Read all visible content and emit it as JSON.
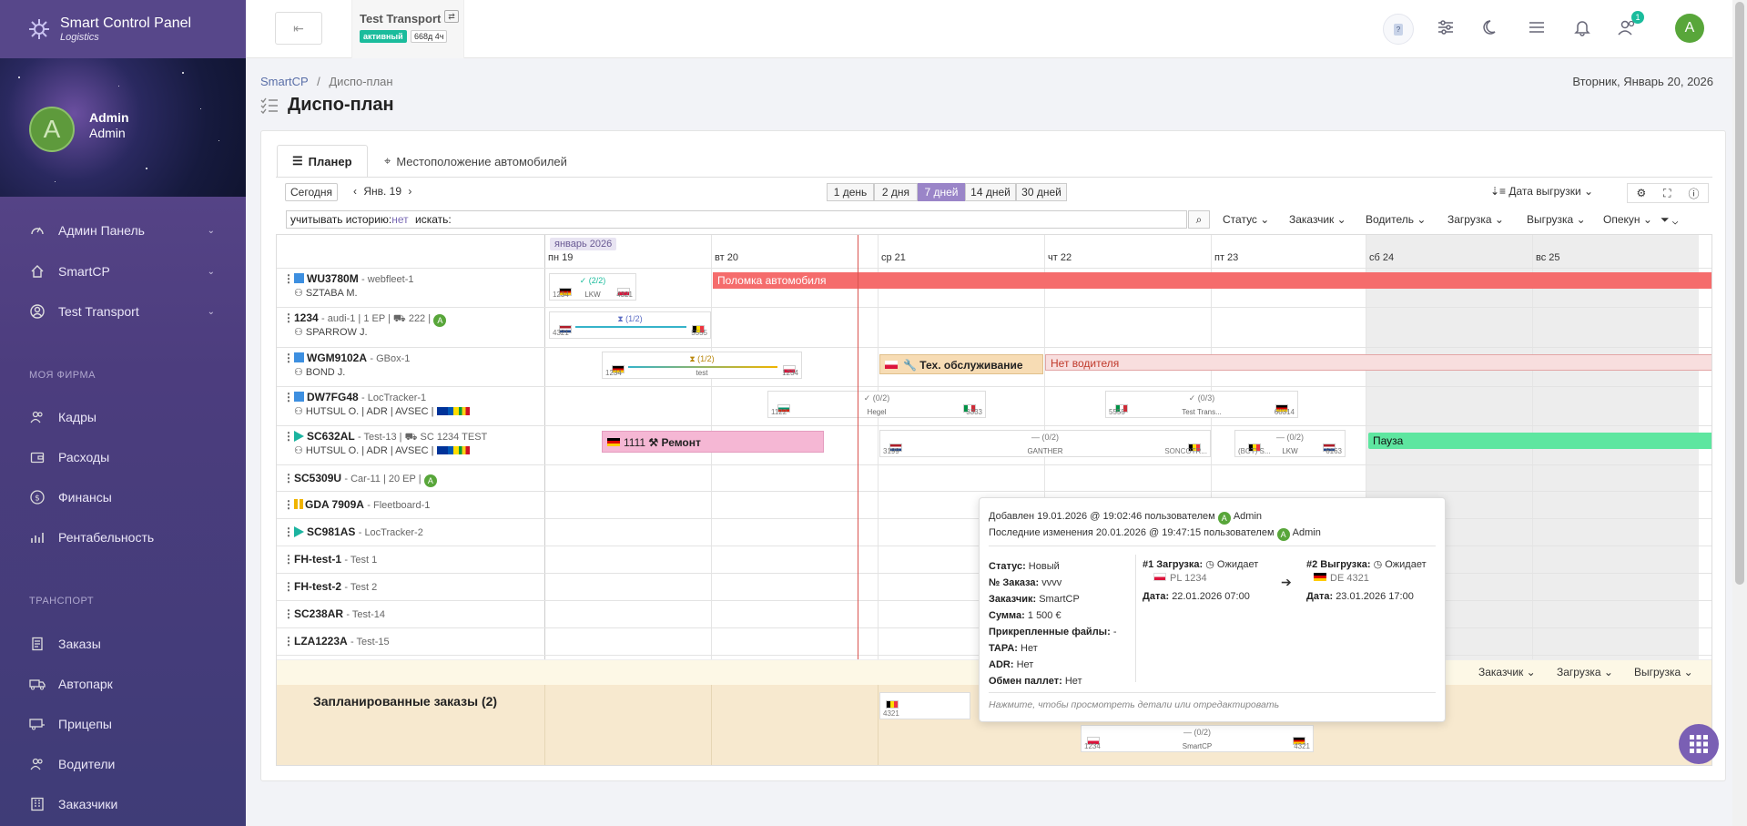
{
  "app": {
    "title": "Smart Control Panel",
    "subtitle": "Logistics"
  },
  "profile": {
    "initial": "A",
    "name": "Admin",
    "role": "Admin"
  },
  "nav": {
    "main": [
      {
        "label": "Админ Панель",
        "icon": "gauge-icon"
      },
      {
        "label": "SmartCP",
        "icon": "home-icon"
      },
      {
        "label": "Test Transport",
        "icon": "user-circle-icon"
      }
    ],
    "section1": "МОЯ ФИРМА",
    "firm": [
      {
        "label": "Кадры",
        "icon": "users-icon"
      },
      {
        "label": "Расходы",
        "icon": "wallet-icon"
      },
      {
        "label": "Финансы",
        "icon": "dollar-icon"
      },
      {
        "label": "Рентабельность",
        "icon": "chart-icon"
      }
    ],
    "section2": "ТРАНСПОРТ",
    "transport": [
      {
        "label": "Заказы",
        "icon": "orders-icon"
      },
      {
        "label": "Автопарк",
        "icon": "truck-icon"
      },
      {
        "label": "Прицепы",
        "icon": "trailer-icon"
      },
      {
        "label": "Водители",
        "icon": "drivers-icon"
      },
      {
        "label": "Заказчики",
        "icon": "customers-icon"
      }
    ]
  },
  "topbar": {
    "back_label": "⇤",
    "company": "Test Transport",
    "status": "активный",
    "time_left": "668д 4ч",
    "help_label": "?",
    "notif_count": "1",
    "user_initial": "A"
  },
  "breadcrumb": {
    "root": "SmartCP",
    "sep": "/",
    "current": "Диспо-план"
  },
  "page_title": "Диспо-план",
  "current_date": "Вторник, Январь 20, 2026",
  "tabs": [
    {
      "label": "Планер",
      "active": true
    },
    {
      "label": "Местоположение автомобилей",
      "active": false
    }
  ],
  "toolbar": {
    "today": "Сегодня",
    "date": "Янв. 19",
    "ranges": [
      "1 день",
      "2 дня",
      "7 дней",
      "14 дней",
      "30 дней"
    ],
    "active_range": "7 дней",
    "sort": "Дата выгрузки"
  },
  "search": {
    "history_label": "учитывать историю:",
    "history_value": "нет",
    "search_label": "искать:"
  },
  "filters": [
    "Статус",
    "Заказчик",
    "Водитель",
    "Загрузка",
    "Выгрузка",
    "Опекун"
  ],
  "calendar": {
    "month": "январь 2026",
    "days": [
      "пн 19",
      "вт 20",
      "ср 21",
      "чт 22",
      "пт 23",
      "сб 24",
      "вс 25"
    ]
  },
  "vehicles": [
    {
      "name": "WU3780M",
      "sub": "- webfleet-1",
      "driver": "SZTABA M."
    },
    {
      "name": "1234",
      "sub": "- audi-1 | 1 EP | ⛟ 222 |",
      "driver": "SPARROW J."
    },
    {
      "name": "WGM9102A",
      "sub": "- GBox-1",
      "driver": "BOND J."
    },
    {
      "name": "DW7FG48",
      "sub": "- LocTracker-1",
      "driver": "HUTSUL O. | ADR | AVSEC |"
    },
    {
      "name": "SC632AL",
      "sub": "- Test-13 | ⛟ SC 1234 TEST",
      "driver": "HUTSUL O. | ADR | AVSEC |"
    },
    {
      "name": "SC5309U",
      "sub": "- Car-11 | 20 EP |",
      "driver": ""
    },
    {
      "name": "GDA 7909A",
      "sub": "- Fleetboard-1",
      "driver": ""
    },
    {
      "name": "SC981AS",
      "sub": "- LocTracker-2",
      "driver": ""
    },
    {
      "name": "FH-test-1",
      "sub": "- Test 1",
      "driver": ""
    },
    {
      "name": "FH-test-2",
      "sub": "- Test 2",
      "driver": ""
    },
    {
      "name": "SC238AR",
      "sub": "- Test-14",
      "driver": ""
    },
    {
      "name": "LZA1223A",
      "sub": "- Test-15",
      "driver": ""
    }
  ],
  "events": {
    "breakdown": "Поломка автомобиля",
    "maintenance": "Тех. обслуживание",
    "no_driver": "Нет водителя",
    "repair_num": "1111",
    "repair": "Ремонт",
    "pause": "Пауза"
  },
  "orders": [
    {
      "mid": "✓ (2/2)",
      "sub": "LKW",
      "l": "1234",
      "r": "4321"
    },
    {
      "mid": "⧗ (1/2)",
      "sub": "",
      "l": "4321",
      "r": "5555"
    },
    {
      "mid": "⧗ (1/2)",
      "sub": "test",
      "l": "1234",
      "r": "1234"
    },
    {
      "mid": "✓ (0/2)",
      "sub": "Hegel",
      "l": "1122",
      "r": "3333"
    },
    {
      "mid": "✓ (0/3)",
      "sub": "Test Trans...",
      "l": "5555",
      "r": "60314"
    },
    {
      "mid": "— (0/2)",
      "sub": "GANTHER",
      "l": "3199",
      "r": "SONCOTR..."
    },
    {
      "mid": "— (0/2)",
      "sub": "LKW",
      "l": "(BCT) S...",
      "r": "6163"
    },
    {
      "mid": "",
      "sub": "",
      "l": "4321",
      "r": ""
    },
    {
      "mid": "— (0/2)",
      "sub": "SmartCP",
      "l": "1234",
      "r": "4321"
    }
  ],
  "planned": {
    "title": "Запланированные заказы (2)",
    "filters": [
      "Заказчик",
      "Загрузка",
      "Выгрузка"
    ]
  },
  "tooltip": {
    "added": "Добавлен 19.01.2026 @ 19:02:46 пользователем",
    "added_user": "Admin",
    "changed": "Последние изменения 20.01.2026 @ 19:47:15 пользователем",
    "changed_user": "Admin",
    "status_k": "Статус:",
    "status_v": "Новый",
    "order_k": "№ Заказа:",
    "order_v": "vvvv",
    "customer_k": "Заказчик:",
    "customer_v": "SmartCP",
    "sum_k": "Сумма:",
    "sum_v": "1 500 €",
    "files_k": "Прикрепленные файлы:",
    "files_v": "-",
    "tapa_k": "TAPA:",
    "tapa_v": "Нет",
    "adr_k": "ADR:",
    "adr_v": "Нет",
    "pallet_k": "Обмен паллет:",
    "pallet_v": "Нет",
    "load_k": "#1 Загрузка:",
    "load_v": "Ожидает",
    "load_place": "PL 1234",
    "load_date_k": "Дата:",
    "load_date_v": "22.01.2026 07:00",
    "unload_k": "#2 Выгрузка:",
    "unload_v": "Ожидает",
    "unload_place": "DE 4321",
    "unload_date_k": "Дата:",
    "unload_date_v": "23.01.2026 17:00",
    "hint": "Нажмите, чтобы просмотреть детали или отредактировать"
  },
  "colors": {
    "accent": "#9a85c8",
    "breakdown": "#f56c6c",
    "maintenance": "#f7dcb4",
    "repair": "#f5b7d4",
    "pause": "#5ee6a0",
    "no_driver": "#f8dede"
  }
}
